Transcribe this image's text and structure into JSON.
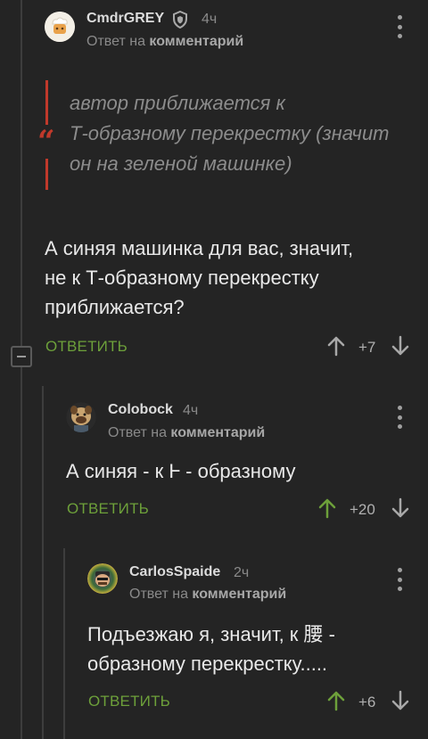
{
  "comments": [
    {
      "username": "CmdrGREY",
      "time": "4ч",
      "reply_prefix": "Ответ на",
      "reply_link": "комментарий",
      "quote": [
        "автор приближается к",
        "Т-образному перекрестку (значит",
        "он на зеленой машинке)"
      ],
      "text": [
        "А синяя машинка для вас, значит,",
        "не к Т-образному перекрестку",
        "приближается?"
      ],
      "reply_label": "ОТВЕТИТЬ",
      "rating": "+7"
    },
    {
      "username": "Colobock",
      "time": "4ч",
      "reply_prefix": "Ответ на",
      "reply_link": "комментарий",
      "text": [
        "А синяя - к Ⱶ - образному"
      ],
      "reply_label": "ОТВЕТИТЬ",
      "rating": "+20"
    },
    {
      "username": "CarlosSpaide",
      "time": "2ч",
      "reply_prefix": "Ответ на",
      "reply_link": "комментарий",
      "text": [
        "Подъезжаю я, значит, к 腰 -",
        "образному перекрестку....."
      ],
      "reply_label": "ОТВЕТИТЬ",
      "rating": "+6"
    }
  ],
  "colors": {
    "background": "#242424",
    "accent_green": "#6da03a",
    "quote_red": "#c0392b"
  },
  "icons": [
    "shield-icon",
    "more-dots-icon",
    "upvote-arrow-icon",
    "downvote-arrow-icon",
    "collapse-thread-icon"
  ]
}
